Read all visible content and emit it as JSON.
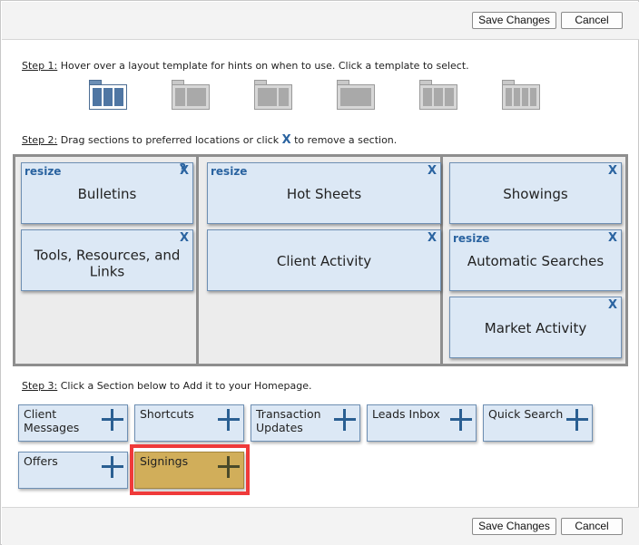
{
  "toolbar": {
    "save_label": "Save Changes",
    "cancel_label": "Cancel"
  },
  "step1": {
    "label": "Step 1:",
    "text": " Hover over a layout template for hints on when to use. Click a template to select."
  },
  "templates": [
    {
      "name": "template-3col-wide-left",
      "selected": true
    },
    {
      "name": "template-2col",
      "selected": false
    },
    {
      "name": "template-2col-alt",
      "selected": false
    },
    {
      "name": "template-1col",
      "selected": false
    },
    {
      "name": "template-3col",
      "selected": false
    },
    {
      "name": "template-4col",
      "selected": false
    }
  ],
  "step2": {
    "label": "Step 2:",
    "text_before": " Drag sections to preferred locations or click ",
    "x": "X",
    "text_after": " to remove a section."
  },
  "sections": {
    "resize": "resize",
    "remove": "X",
    "help": "?",
    "bulletins": "Bulletins",
    "tools": "Tools, Resources, and Links",
    "hot_sheets": "Hot Sheets",
    "client_activity": "Client Activity",
    "showings": "Showings",
    "automatic_searches": "Automatic Searches",
    "market_activity": "Market Activity"
  },
  "step3": {
    "label": "Step 3:",
    "text": " Click a Section below to Add it to your Homepage."
  },
  "tiles": {
    "client_messages": "Client Messages",
    "shortcuts": "Shortcuts",
    "transaction_updates": "Transaction Updates",
    "leads_inbox": "Leads Inbox",
    "quick_search": "Quick Search",
    "offers": "Offers",
    "signings": "Signings"
  },
  "colors": {
    "accent": "#2a63a0",
    "section_bg": "#dce8f5",
    "highlight": "#ef3a3a",
    "selected_tile": "#d1ae5a"
  }
}
